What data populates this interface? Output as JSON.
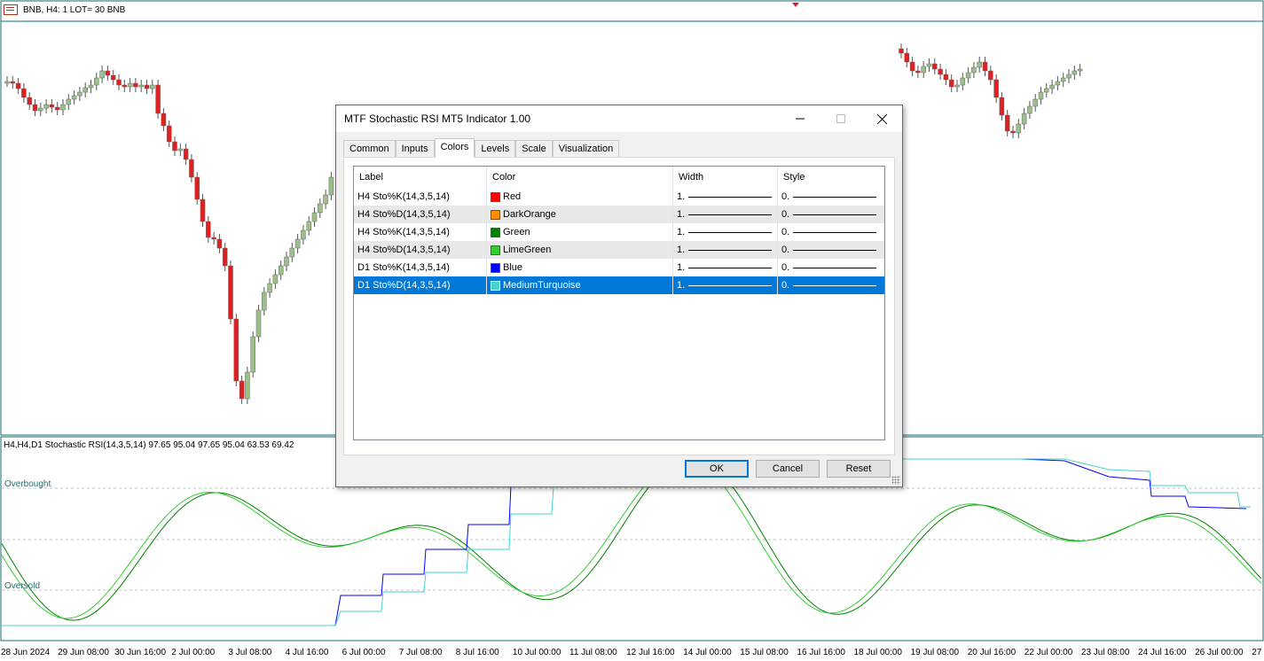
{
  "chart": {
    "symbol_info": "BNB, H4:  1 LOT= 30 BNB",
    "indicator_info": "H4,H4,D1 Stochastic RSI(14,3,5,14) 97.65 95.04 97.65 95.04 63.53 69.42",
    "level_overbought": "Overbought",
    "level_oversold": "Oversold",
    "time_labels": [
      "28 Jun 2024",
      "29 Jun 08:00",
      "30 Jun 16:00",
      "2 Jul 00:00",
      "3 Jul 08:00",
      "4 Jul 16:00",
      "6 Jul 00:00",
      "7 Jul 08:00",
      "8 Jul 16:00",
      "10 Jul 00:00",
      "11 Jul 08:00",
      "12 Jul 16:00",
      "14 Jul 00:00",
      "15 Jul 08:00",
      "16 Jul 16:00",
      "18 Jul 00:00",
      "19 Jul 08:00",
      "20 Jul 16:00",
      "22 Jul 00:00",
      "23 Jul 08:00",
      "24 Jul 16:00",
      "26 Jul 00:00",
      "27 J"
    ],
    "colors": {
      "bull": "#9bc08a",
      "bear": "#e02020",
      "grid": "#c0c0c0",
      "frame": "#0d6e70"
    }
  },
  "dialog": {
    "title": "MTF Stochastic RSI MT5 Indicator 1.00",
    "minimize_icon": "minimize-icon",
    "maximize_icon": "maximize-icon",
    "close_icon": "close-icon",
    "tabs": [
      "Common",
      "Inputs",
      "Colors",
      "Levels",
      "Scale",
      "Visualization"
    ],
    "active_tab": "Colors",
    "columns": [
      "Label",
      "Color",
      "Width",
      "Style"
    ],
    "rows": [
      {
        "label": "H4 Sto%K(14,3,5,14)",
        "color_name": "Red",
        "color": "#ff0000",
        "width": "1.",
        "style": "0."
      },
      {
        "label": "H4 Sto%D(14,3,5,14)",
        "color_name": "DarkOrange",
        "color": "#ff8c00",
        "width": "1.",
        "style": "0."
      },
      {
        "label": "H4 Sto%K(14,3,5,14)",
        "color_name": "Green",
        "color": "#008000",
        "width": "1.",
        "style": "0."
      },
      {
        "label": "H4 Sto%D(14,3,5,14)",
        "color_name": "LimeGreen",
        "color": "#32cd32",
        "width": "1.",
        "style": "0."
      },
      {
        "label": "D1 Sto%K(14,3,5,14)",
        "color_name": "Blue",
        "color": "#0000ff",
        "width": "1.",
        "style": "0."
      },
      {
        "label": "D1 Sto%D(14,3,5,14)",
        "color_name": "MediumTurquoise",
        "color": "#48d1cc",
        "width": "1.",
        "style": "0."
      }
    ],
    "selected_row": 5,
    "buttons": {
      "ok": "OK",
      "cancel": "Cancel",
      "reset": "Reset"
    }
  }
}
